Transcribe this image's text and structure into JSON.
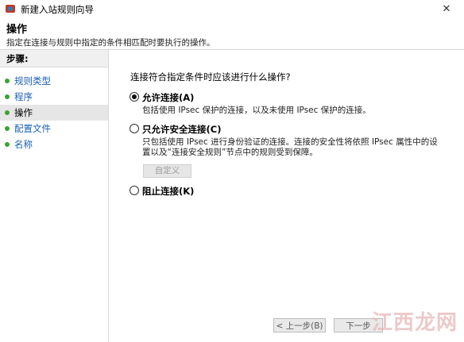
{
  "window": {
    "title": "新建入站规则向导",
    "close_glyph": "✕"
  },
  "header": {
    "title": "操作",
    "subtitle": "指定在连接与规则中指定的条件相匹配时要执行的操作。"
  },
  "sidebar": {
    "heading": "步骤:",
    "items": [
      {
        "label": "规则类型"
      },
      {
        "label": "程序"
      },
      {
        "label": "操作"
      },
      {
        "label": "配置文件"
      },
      {
        "label": "名称"
      }
    ],
    "active_index": 2
  },
  "main": {
    "question": "连接符合指定条件时应该进行什么操作?",
    "options": [
      {
        "label": "允许连接(A)",
        "checked": true,
        "description": "包括使用 IPsec 保护的连接，以及未使用 IPsec 保护的连接。"
      },
      {
        "label": "只允许安全连接(C)",
        "checked": false,
        "description": "只包括使用 IPsec 进行身份验证的连接。连接的安全性将依照 IPsec 属性中的设\n置以及“连接安全规则”节点中的规则受到保障。"
      },
      {
        "label": "阻止连接(K)",
        "checked": false,
        "description": ""
      }
    ],
    "customize_label": "自定义"
  },
  "footer": {
    "back_label": "< 上一步(B)",
    "next_label": "下一步"
  },
  "watermark": "江西龙网"
}
